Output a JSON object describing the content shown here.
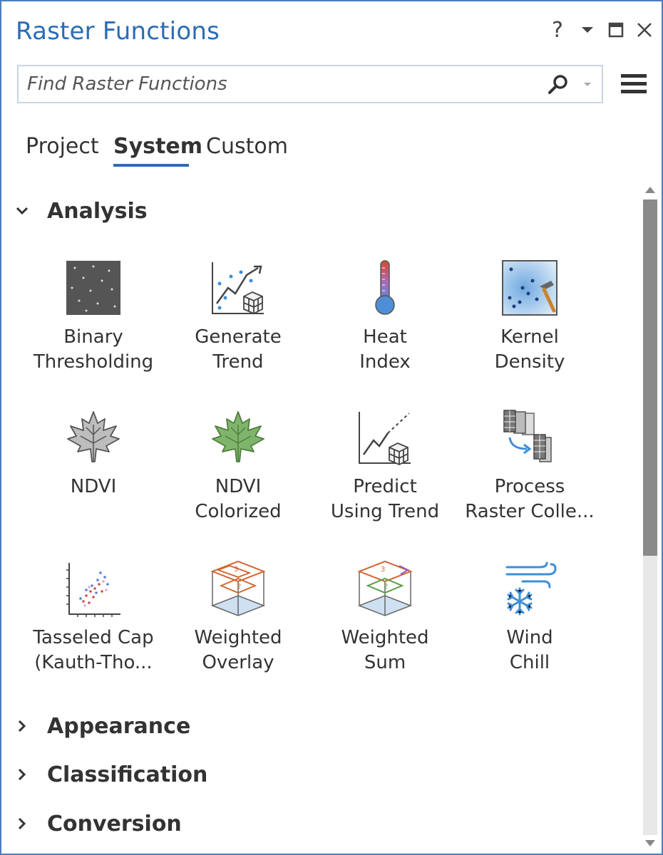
{
  "window": {
    "title": "Raster Functions",
    "help_label": "?"
  },
  "search": {
    "placeholder": "Find Raster Functions"
  },
  "tabs": [
    {
      "label": "Project",
      "active": false
    },
    {
      "label": "System",
      "active": true
    },
    {
      "label": "Custom",
      "active": false
    }
  ],
  "sections": [
    {
      "label": "Analysis",
      "expanded": true
    },
    {
      "label": "Appearance",
      "expanded": false
    },
    {
      "label": "Classification",
      "expanded": false
    },
    {
      "label": "Conversion",
      "expanded": false
    }
  ],
  "functions": [
    {
      "label": "Binary\nThresholding",
      "icon": "binary-thresholding-icon"
    },
    {
      "label": "Generate\nTrend",
      "icon": "generate-trend-icon"
    },
    {
      "label": "Heat\nIndex",
      "icon": "thermometer-icon"
    },
    {
      "label": "Kernel\nDensity",
      "icon": "kernel-density-icon"
    },
    {
      "label": "NDVI",
      "icon": "leaf-gray-icon"
    },
    {
      "label": "NDVI\nColorized",
      "icon": "leaf-green-icon"
    },
    {
      "label": "Predict\nUsing Trend",
      "icon": "predict-trend-icon"
    },
    {
      "label": "Process\nRaster Colle...",
      "icon": "raster-collection-icon"
    },
    {
      "label": "Tasseled Cap\n(Kauth-Tho...",
      "icon": "scatter-plot-icon"
    },
    {
      "label": "Weighted\nOverlay",
      "icon": "weighted-overlay-icon"
    },
    {
      "label": "Weighted\nSum",
      "icon": "weighted-sum-icon"
    },
    {
      "label": "Wind\nChill",
      "icon": "wind-snowflake-icon"
    }
  ],
  "scrollbar": {
    "position_fraction": 0.0,
    "visible_fraction": 0.56
  },
  "colors": {
    "accent": "#2b6cb5",
    "border": "#4a7fc1"
  }
}
